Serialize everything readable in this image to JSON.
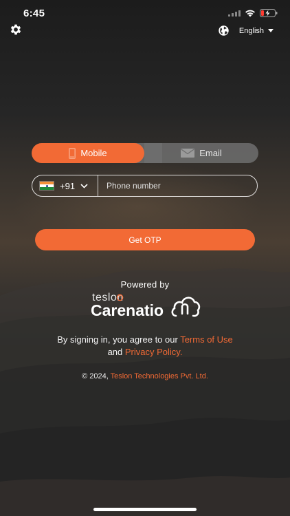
{
  "status_bar": {
    "time": "6:45"
  },
  "header": {
    "settings_icon": "gear-icon",
    "language_icon": "globe-icon",
    "language": "English"
  },
  "tabs": [
    {
      "label": "Mobile",
      "icon": "phone-icon",
      "active": true
    },
    {
      "label": "Email",
      "icon": "mail-icon",
      "active": false
    }
  ],
  "phone": {
    "country_code": "+91",
    "flag": "india-flag-icon",
    "placeholder": "Phone number"
  },
  "otp_button": "Get OTP",
  "powered": {
    "text": "Powered by",
    "brand_top": "teslon",
    "brand_main": "Carenatio"
  },
  "terms": {
    "prefix": "By signing in, you agree to our ",
    "terms_link": "Terms of Use",
    "middle": "and ",
    "privacy_link": "Privacy Policy."
  },
  "footer": {
    "copyright": "© 2024, ",
    "company": "Teslon Technologies Pvt. Ltd."
  },
  "colors": {
    "accent": "#f26a35",
    "tab_inactive": "#6e6e6e"
  }
}
